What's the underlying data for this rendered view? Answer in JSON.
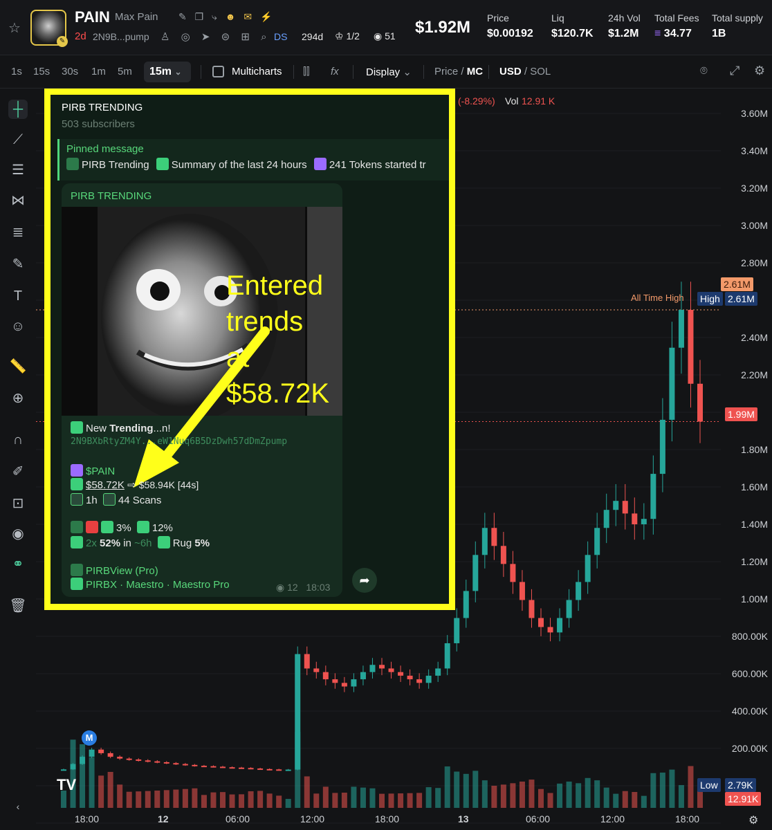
{
  "header": {
    "ticker": "PAIN",
    "name": "Max Pain",
    "age": "2d",
    "address": "2N9B...pump",
    "ds_label": "DS",
    "ds_age": "294d",
    "holders_ratio": "1/2",
    "watchers": "51",
    "market_cap": "$1.92M",
    "stats": [
      {
        "label": "Price",
        "value": "$0.00192"
      },
      {
        "label": "Liq",
        "value": "$120.7K"
      },
      {
        "label": "24h Vol",
        "value": "$1.2M"
      },
      {
        "label": "Total Fees",
        "value": "34.77"
      },
      {
        "label": "Total supply",
        "value": "1B"
      }
    ]
  },
  "toolbar": {
    "timeframes": [
      "1s",
      "15s",
      "30s",
      "1m",
      "5m"
    ],
    "active_timeframe": "15m",
    "multicharts": "Multicharts",
    "display": "Display",
    "price_label": "Price",
    "mc_label": "MC",
    "usd_label": "USD",
    "sol_label": "SOL"
  },
  "chart_data": {
    "type": "candlestick",
    "x_ticks": [
      "18:00",
      "12",
      "06:00",
      "12:00",
      "18:00",
      "13",
      "06:00",
      "12:00",
      "18:00"
    ],
    "y_ticks": [
      "3.60M",
      "3.40M",
      "3.20M",
      "3.00M",
      "2.80M",
      "2.40M",
      "2.20M",
      "1.80M",
      "1.60M",
      "1.40M",
      "1.20M",
      "1.00M",
      "800.00K",
      "600.00K",
      "400.00K",
      "200.00K"
    ],
    "ylim": [
      0,
      3700000
    ],
    "change": "(-8.29%)",
    "vol_label": "Vol",
    "vol_value": "12.91 K",
    "all_time_high_label": "All Time High",
    "high_label": "High",
    "high_value": "2.61M",
    "ath_value": "2.61M",
    "current_value": "1.99M",
    "low_label": "Low",
    "low_value": "2.79K",
    "volume_value": "12.91K",
    "marker": "M",
    "watermark": "TV",
    "series": [
      {
        "name": "Market Cap",
        "values": [
          60000,
          90000,
          130000,
          170000,
          150000,
          130000,
          120000,
          115000,
          110000,
          105000,
          100000,
          95000,
          90000,
          85000,
          80000,
          78000,
          75000,
          72000,
          70000,
          68000,
          65000,
          62000,
          60000,
          58720,
          58940,
          700000,
          620000,
          600000,
          560000,
          540000,
          520000,
          560000,
          600000,
          640000,
          620000,
          600000,
          580000,
          560000,
          540000,
          580000,
          620000,
          760000,
          900000,
          1050000,
          1250000,
          1400000,
          1300000,
          1200000,
          1100000,
          1000000,
          900000,
          850000,
          820000,
          900000,
          1000000,
          1100000,
          1250000,
          1400000,
          1500000,
          1550000,
          1480000,
          1420000,
          1450000,
          1700000,
          2000000,
          2400000,
          2610000,
          2200000,
          1990000
        ]
      }
    ]
  },
  "telegram": {
    "channel_title": "PIRB TRENDING",
    "subscribers": "503 subscribers",
    "pinned_title": "Pinned message",
    "pinned_items": [
      "PIRB Trending",
      "Summary of the last 24 hours",
      "241 Tokens started tr"
    ],
    "message": {
      "source": "PIRB TRENDING",
      "image_caption_line1": "Entered trends",
      "image_caption_line2": "at $58.72K",
      "new_trending_prefix": "New",
      "new_trending_bold": "Trending",
      "new_trending_suffix": "...n!",
      "contract": "2N9BXbRtyZM4Y...eW1Nuq6B5DzDwh57dDmZpump",
      "ticker": "$PAIN",
      "mc_entry": "$58.72K",
      "mc_arrow": "⇨",
      "mc_now": "$58.94K [44s]",
      "age": "1h",
      "scans": "44 Scans",
      "pct_a": "3%",
      "pct_b": "12%",
      "multiplier": "2x",
      "multiplier_pct": "52%",
      "in_label": "in",
      "in_time": "~6h",
      "rug_label": "Rug",
      "rug_pct": "5%",
      "view_link": "PIRBView (Pro)",
      "buy_links": "PIRBX · Maestro · Maestro Pro",
      "views": "12",
      "time": "18:03"
    }
  },
  "colors": {
    "accent_yellow": "#ffff1a",
    "up": "#26a69a",
    "down": "#ef5350",
    "ath": "#f39a6a",
    "tg_green": "#58d87b"
  }
}
